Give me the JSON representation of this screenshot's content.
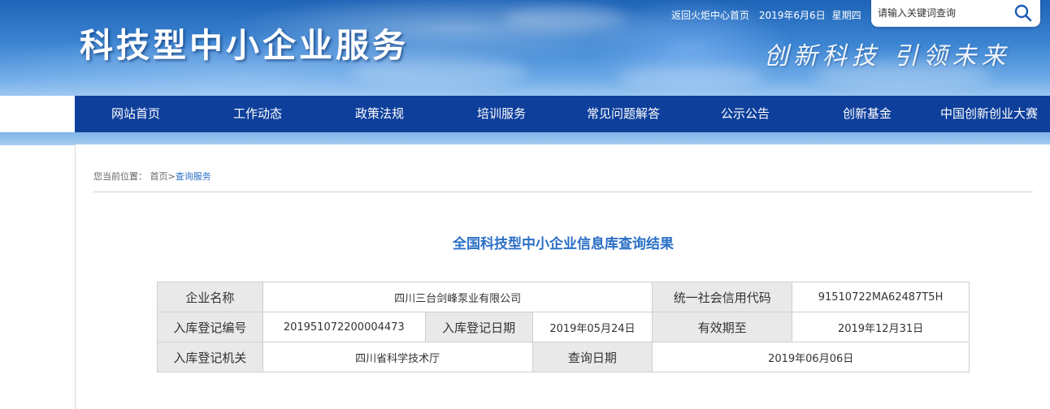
{
  "header": {
    "site_title": "科技型中小企业服务",
    "slogan": "创新科技 引领未来",
    "home_link": "返回火炬中心首页",
    "date": "2019年6月6日",
    "weekday": "星期四",
    "search": {
      "placeholder": "请输入关键词查询",
      "icon": "search-icon"
    }
  },
  "nav": {
    "items": [
      {
        "label": "网站首页"
      },
      {
        "label": "工作动态"
      },
      {
        "label": "政策法规"
      },
      {
        "label": "培训服务"
      },
      {
        "label": "常见问题解答"
      },
      {
        "label": "公示公告"
      },
      {
        "label": "创新基金"
      },
      {
        "label": "中国创新创业大赛"
      }
    ]
  },
  "breadcrumb": {
    "prefix": "您当前位置：",
    "home": "首页",
    "separator": ">",
    "current": "查询服务"
  },
  "result": {
    "title": "全国科技型中小企业信息库查询结果",
    "rows": [
      [
        {
          "label": "企业名称"
        },
        {
          "value": "四川三台剑峰泵业有限公司"
        },
        {
          "label": "统一社会信用代码"
        },
        {
          "value": "91510722MA62487T5H"
        }
      ],
      [
        {
          "label": "入库登记编号"
        },
        {
          "value": "201951072200004473"
        },
        {
          "label": "入库登记日期"
        },
        {
          "value": "2019年05月24日"
        },
        {
          "label": "有效期至"
        },
        {
          "value": "2019年12月31日"
        }
      ],
      [
        {
          "label": "入库登记机关"
        },
        {
          "value": "四川省科学技术厅"
        },
        {
          "label": "查询日期"
        },
        {
          "value": "2019年06月06日"
        }
      ]
    ]
  },
  "colors": {
    "nav_bg": "#0e3f9b",
    "accent_blue": "#2a6fc6",
    "label_bg": "#e9e9e9"
  }
}
